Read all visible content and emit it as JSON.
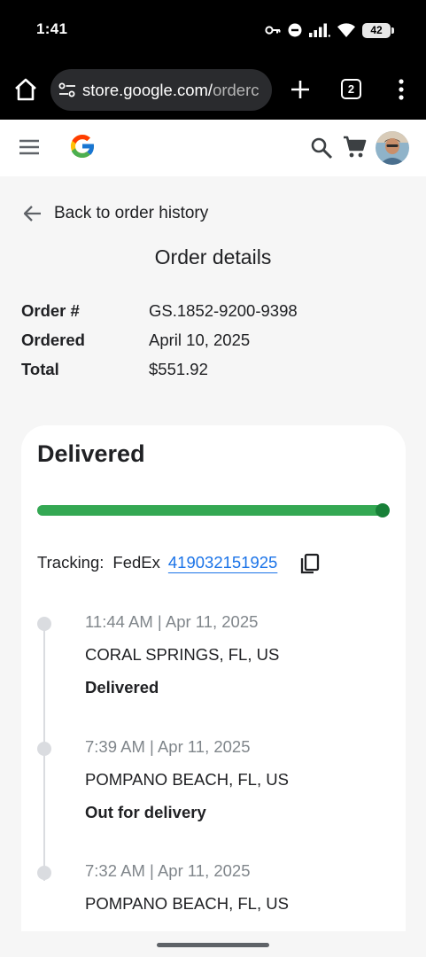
{
  "status_bar": {
    "time": "1:41",
    "battery": "42",
    "icons": [
      "vpn-key-icon",
      "do-not-disturb-icon",
      "signal-icon",
      "wifi-icon",
      "battery-icon"
    ]
  },
  "browser": {
    "url_main": "store.google.com/",
    "url_faded": "orderc",
    "tab_count": "2",
    "icons": [
      "home-icon",
      "site-settings-icon",
      "new-tab-icon",
      "tabs-icon",
      "more-menu-icon"
    ]
  },
  "header": {
    "icons": [
      "hamburger-menu-icon",
      "google-logo",
      "search-icon",
      "cart-icon",
      "avatar"
    ]
  },
  "navigation": {
    "back_label": "Back to order history"
  },
  "page": {
    "title": "Order details"
  },
  "order_summary": [
    {
      "label": "Order #",
      "value": "GS.1852-9200-9398"
    },
    {
      "label": "Ordered",
      "value": "April 10, 2025"
    },
    {
      "label": "Total",
      "value": "$551.92"
    }
  ],
  "shipment": {
    "status": "Delivered",
    "progress": 1.0,
    "tracking_label": "Tracking:",
    "carrier": "FedEx",
    "tracking_number": "419032151925",
    "colors": {
      "progress": "#34a853",
      "link": "#1a73e8"
    },
    "events": [
      {
        "time": "11:44 AM | Apr 11, 2025",
        "place": "CORAL SPRINGS, FL, US",
        "status": "Delivered"
      },
      {
        "time": "7:39 AM | Apr 11, 2025",
        "place": "POMPANO BEACH, FL, US",
        "status": "Out for delivery"
      },
      {
        "time": "7:32 AM | Apr 11, 2025",
        "place": "POMPANO BEACH, FL, US",
        "status": ""
      }
    ]
  }
}
